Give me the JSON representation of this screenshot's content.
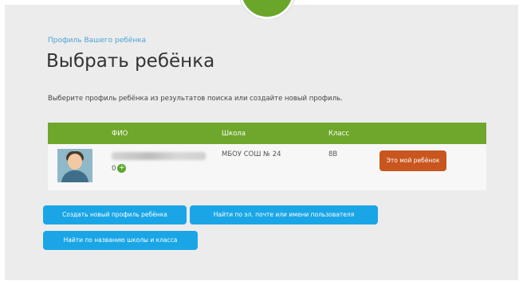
{
  "breadcrumb": "Профиль Вашего ребёнка",
  "title": "Выбрать ребёнка",
  "instruction": "Выберите профиль ребёнка из результатов поиска или создайте новый профиль.",
  "table": {
    "headers": [
      "",
      "ФИО",
      "Школа",
      "Класс",
      ""
    ],
    "rows": [
      {
        "name": "",
        "points": "0",
        "school": "МБОУ СОШ № 24",
        "class": "8В",
        "action": "Это мой ребёнок"
      }
    ]
  },
  "buttons": {
    "create": "Создать новый профиль ребёнка",
    "find_email": "Найти по эл. почте или имени пользователя",
    "find_school": "Найти по названию школы и класса"
  },
  "icons": [
    "logo-icon",
    "avatar-icon",
    "plus-icon"
  ],
  "colors": {
    "header_green": "#6ea72b",
    "action_orange": "#c8561e",
    "button_blue": "#1aa6e6",
    "link_blue": "#4aa3d8"
  }
}
